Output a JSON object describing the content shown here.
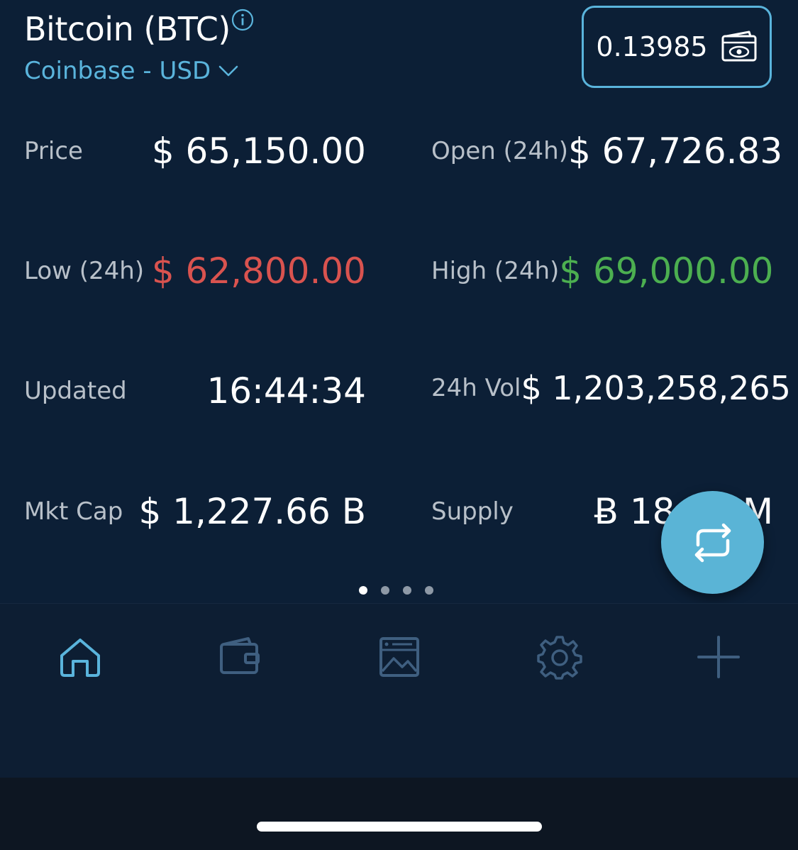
{
  "header": {
    "coin_title": "Bitcoin (BTC)",
    "exchange": "Coinbase - USD",
    "holdings": "0.13985"
  },
  "stats": {
    "price": {
      "label": "Price",
      "value": "$ 65,150.00"
    },
    "open": {
      "label": "Open (24h)",
      "value": "$ 67,726.83"
    },
    "low": {
      "label": "Low (24h)",
      "value": "$ 62,800.00"
    },
    "high": {
      "label": "High (24h)",
      "value": "$ 69,000.00"
    },
    "updated": {
      "label": "Updated",
      "value": "16:44:34"
    },
    "volume": {
      "label": "24h Vol",
      "value": "$ 1,203,258,265"
    },
    "mkt_cap": {
      "label": "Mkt Cap",
      "value": "$ 1,227.66 B"
    },
    "supply": {
      "label": "Supply",
      "value": "Ƀ 18.71 M"
    }
  },
  "pager": {
    "pages": 4,
    "active": 1
  },
  "tabs": [
    "home-icon",
    "wallet-icon",
    "news-icon",
    "settings-icon",
    "add-icon"
  ],
  "colors": {
    "background": "#0c1f36",
    "accent": "#5ab4dc",
    "negative": "#d9534f",
    "positive": "#4caf50",
    "label": "#b8c0c9",
    "inactive_icon": "#3f5f80"
  }
}
